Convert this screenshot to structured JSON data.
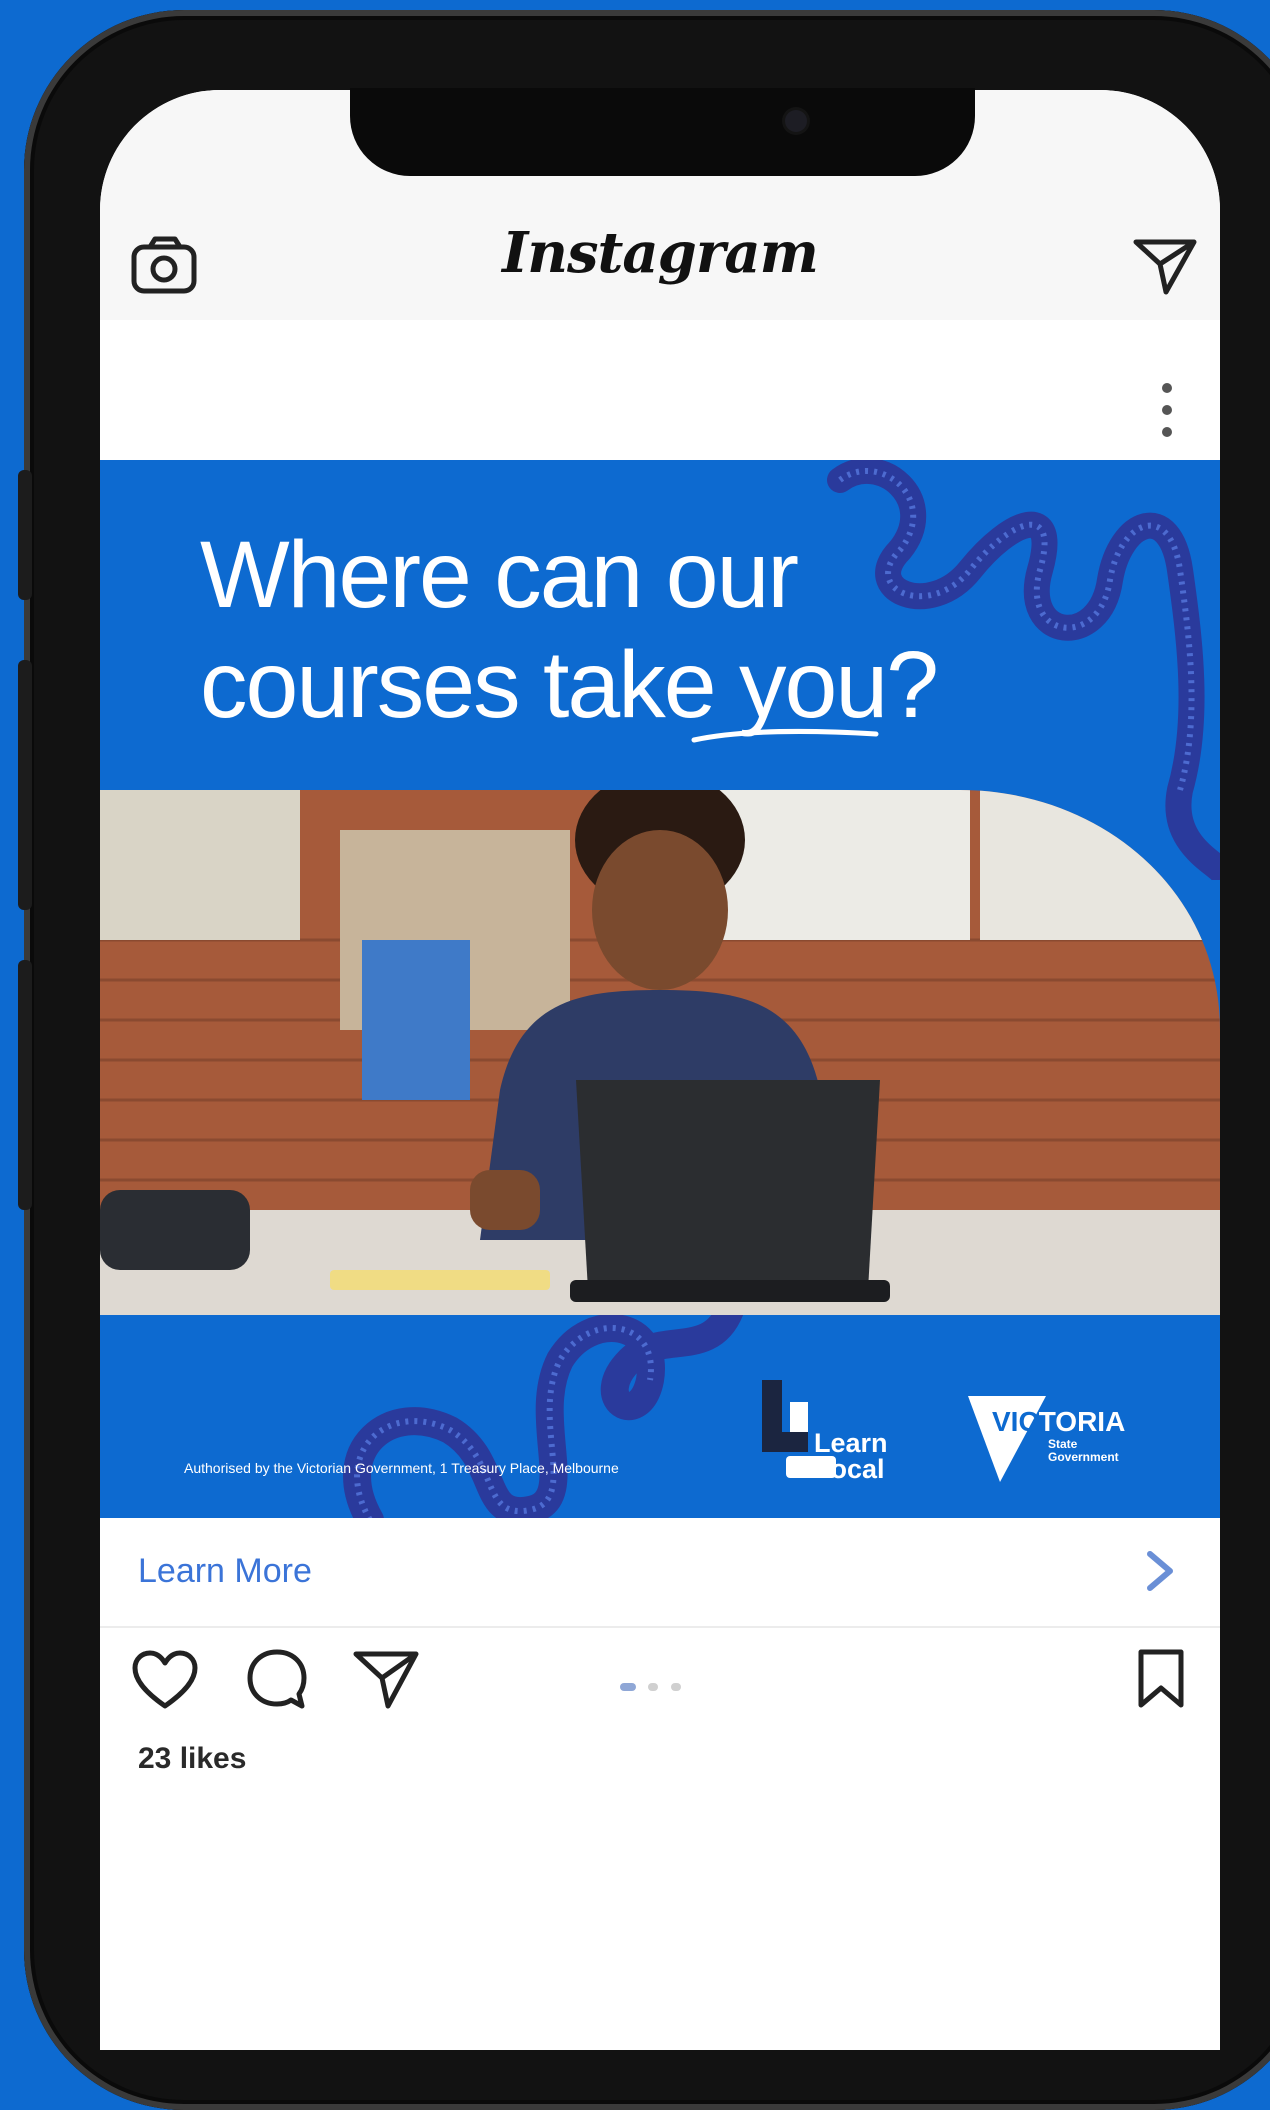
{
  "header": {
    "logo_text": "Instagram",
    "left_icon": "camera-icon",
    "right_icon": "direct-message-icon"
  },
  "post": {
    "menu_icon": "more-options-icon",
    "headline_line1": "Where can our",
    "headline_line2_prefix": "courses take ",
    "headline_line2_highlight": "you?",
    "disclaimer": "Authorised by the Victorian Government, 1 Treasury Place, Melbourne",
    "learn_local_logo": [
      "Learn",
      "Local"
    ],
    "victoria_logo": {
      "title": "VICTORIA",
      "sub1": "State",
      "sub2": "Government"
    },
    "brand_color": "#0d6ad0",
    "squiggle_color": "#2a3a9c"
  },
  "cta": {
    "label": "Learn More",
    "chevron_icon": "chevron-right-icon"
  },
  "actions": {
    "icons": [
      "heart-icon",
      "comment-icon",
      "share-icon",
      "bookmark-icon"
    ],
    "carousel_pages": 3,
    "carousel_active": 1
  },
  "likes": "23 likes"
}
